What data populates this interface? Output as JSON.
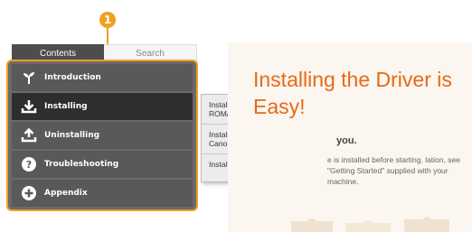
{
  "callout": {
    "number": "1"
  },
  "tabs": [
    {
      "label": "Contents",
      "active": true
    },
    {
      "label": "Search",
      "active": false
    }
  ],
  "menu": {
    "items": [
      {
        "label": "Introduction",
        "icon": "sprout-icon"
      },
      {
        "label": "Installing",
        "icon": "download-icon",
        "active": true
      },
      {
        "label": "Uninstalling",
        "icon": "upload-icon"
      },
      {
        "label": "Troubleshooting",
        "icon": "question-icon"
      },
      {
        "label": "Appendix",
        "icon": "plus-icon"
      }
    ]
  },
  "submenu": {
    "items": [
      {
        "label": "Installing from the Supplied CD-ROM/DVD-ROM"
      },
      {
        "label": "Installing after Downloading from the Canon Website"
      },
      {
        "label": "Installing to Use WSD"
      }
    ]
  },
  "preview": {
    "title": "Installing the Driver is Easy!",
    "subtitle": "you.",
    "body": "e is installed before starting. lation, see \"Getting Started\" supplied with your machine."
  },
  "colors": {
    "accent": "#f0a020",
    "title_orange": "#e86a18",
    "menu_bg": "#595959",
    "menu_active": "#2e2e2e"
  }
}
